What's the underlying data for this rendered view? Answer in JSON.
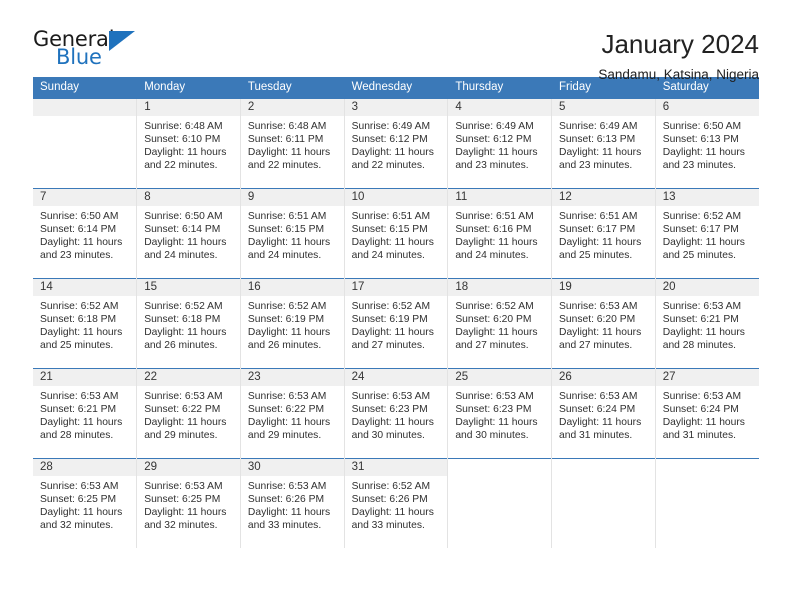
{
  "brand": {
    "word_one": "General",
    "word_two": "Blue",
    "triangle_icon": "blue-triangle-icon"
  },
  "header": {
    "title": "January 2024",
    "subtitle": "Sandamu, Katsina, Nigeria"
  },
  "theme": {
    "header_blue": "#3b79b8",
    "band_gray": "#f0f0f0",
    "brand_blue": "#1f72bd",
    "text": "#303030"
  },
  "weekday_headers": [
    "Sunday",
    "Monday",
    "Tuesday",
    "Wednesday",
    "Thursday",
    "Friday",
    "Saturday"
  ],
  "labels": {
    "sunrise_prefix": "Sunrise:",
    "sunset_prefix": "Sunset:",
    "daylight_prefix": "Daylight:"
  },
  "weeks": [
    [
      {
        "day": "",
        "blank": true
      },
      {
        "day": "1",
        "sunrise": "Sunrise: 6:48 AM",
        "sunset": "Sunset: 6:10 PM",
        "daylight_1": "Daylight: 11 hours",
        "daylight_2": "and 22 minutes."
      },
      {
        "day": "2",
        "sunrise": "Sunrise: 6:48 AM",
        "sunset": "Sunset: 6:11 PM",
        "daylight_1": "Daylight: 11 hours",
        "daylight_2": "and 22 minutes."
      },
      {
        "day": "3",
        "sunrise": "Sunrise: 6:49 AM",
        "sunset": "Sunset: 6:12 PM",
        "daylight_1": "Daylight: 11 hours",
        "daylight_2": "and 22 minutes."
      },
      {
        "day": "4",
        "sunrise": "Sunrise: 6:49 AM",
        "sunset": "Sunset: 6:12 PM",
        "daylight_1": "Daylight: 11 hours",
        "daylight_2": "and 23 minutes."
      },
      {
        "day": "5",
        "sunrise": "Sunrise: 6:49 AM",
        "sunset": "Sunset: 6:13 PM",
        "daylight_1": "Daylight: 11 hours",
        "daylight_2": "and 23 minutes."
      },
      {
        "day": "6",
        "sunrise": "Sunrise: 6:50 AM",
        "sunset": "Sunset: 6:13 PM",
        "daylight_1": "Daylight: 11 hours",
        "daylight_2": "and 23 minutes."
      }
    ],
    [
      {
        "day": "7",
        "sunrise": "Sunrise: 6:50 AM",
        "sunset": "Sunset: 6:14 PM",
        "daylight_1": "Daylight: 11 hours",
        "daylight_2": "and 23 minutes."
      },
      {
        "day": "8",
        "sunrise": "Sunrise: 6:50 AM",
        "sunset": "Sunset: 6:14 PM",
        "daylight_1": "Daylight: 11 hours",
        "daylight_2": "and 24 minutes."
      },
      {
        "day": "9",
        "sunrise": "Sunrise: 6:51 AM",
        "sunset": "Sunset: 6:15 PM",
        "daylight_1": "Daylight: 11 hours",
        "daylight_2": "and 24 minutes."
      },
      {
        "day": "10",
        "sunrise": "Sunrise: 6:51 AM",
        "sunset": "Sunset: 6:15 PM",
        "daylight_1": "Daylight: 11 hours",
        "daylight_2": "and 24 minutes."
      },
      {
        "day": "11",
        "sunrise": "Sunrise: 6:51 AM",
        "sunset": "Sunset: 6:16 PM",
        "daylight_1": "Daylight: 11 hours",
        "daylight_2": "and 24 minutes."
      },
      {
        "day": "12",
        "sunrise": "Sunrise: 6:51 AM",
        "sunset": "Sunset: 6:17 PM",
        "daylight_1": "Daylight: 11 hours",
        "daylight_2": "and 25 minutes."
      },
      {
        "day": "13",
        "sunrise": "Sunrise: 6:52 AM",
        "sunset": "Sunset: 6:17 PM",
        "daylight_1": "Daylight: 11 hours",
        "daylight_2": "and 25 minutes."
      }
    ],
    [
      {
        "day": "14",
        "sunrise": "Sunrise: 6:52 AM",
        "sunset": "Sunset: 6:18 PM",
        "daylight_1": "Daylight: 11 hours",
        "daylight_2": "and 25 minutes."
      },
      {
        "day": "15",
        "sunrise": "Sunrise: 6:52 AM",
        "sunset": "Sunset: 6:18 PM",
        "daylight_1": "Daylight: 11 hours",
        "daylight_2": "and 26 minutes."
      },
      {
        "day": "16",
        "sunrise": "Sunrise: 6:52 AM",
        "sunset": "Sunset: 6:19 PM",
        "daylight_1": "Daylight: 11 hours",
        "daylight_2": "and 26 minutes."
      },
      {
        "day": "17",
        "sunrise": "Sunrise: 6:52 AM",
        "sunset": "Sunset: 6:19 PM",
        "daylight_1": "Daylight: 11 hours",
        "daylight_2": "and 27 minutes."
      },
      {
        "day": "18",
        "sunrise": "Sunrise: 6:52 AM",
        "sunset": "Sunset: 6:20 PM",
        "daylight_1": "Daylight: 11 hours",
        "daylight_2": "and 27 minutes."
      },
      {
        "day": "19",
        "sunrise": "Sunrise: 6:53 AM",
        "sunset": "Sunset: 6:20 PM",
        "daylight_1": "Daylight: 11 hours",
        "daylight_2": "and 27 minutes."
      },
      {
        "day": "20",
        "sunrise": "Sunrise: 6:53 AM",
        "sunset": "Sunset: 6:21 PM",
        "daylight_1": "Daylight: 11 hours",
        "daylight_2": "and 28 minutes."
      }
    ],
    [
      {
        "day": "21",
        "sunrise": "Sunrise: 6:53 AM",
        "sunset": "Sunset: 6:21 PM",
        "daylight_1": "Daylight: 11 hours",
        "daylight_2": "and 28 minutes."
      },
      {
        "day": "22",
        "sunrise": "Sunrise: 6:53 AM",
        "sunset": "Sunset: 6:22 PM",
        "daylight_1": "Daylight: 11 hours",
        "daylight_2": "and 29 minutes."
      },
      {
        "day": "23",
        "sunrise": "Sunrise: 6:53 AM",
        "sunset": "Sunset: 6:22 PM",
        "daylight_1": "Daylight: 11 hours",
        "daylight_2": "and 29 minutes."
      },
      {
        "day": "24",
        "sunrise": "Sunrise: 6:53 AM",
        "sunset": "Sunset: 6:23 PM",
        "daylight_1": "Daylight: 11 hours",
        "daylight_2": "and 30 minutes."
      },
      {
        "day": "25",
        "sunrise": "Sunrise: 6:53 AM",
        "sunset": "Sunset: 6:23 PM",
        "daylight_1": "Daylight: 11 hours",
        "daylight_2": "and 30 minutes."
      },
      {
        "day": "26",
        "sunrise": "Sunrise: 6:53 AM",
        "sunset": "Sunset: 6:24 PM",
        "daylight_1": "Daylight: 11 hours",
        "daylight_2": "and 31 minutes."
      },
      {
        "day": "27",
        "sunrise": "Sunrise: 6:53 AM",
        "sunset": "Sunset: 6:24 PM",
        "daylight_1": "Daylight: 11 hours",
        "daylight_2": "and 31 minutes."
      }
    ],
    [
      {
        "day": "28",
        "sunrise": "Sunrise: 6:53 AM",
        "sunset": "Sunset: 6:25 PM",
        "daylight_1": "Daylight: 11 hours",
        "daylight_2": "and 32 minutes."
      },
      {
        "day": "29",
        "sunrise": "Sunrise: 6:53 AM",
        "sunset": "Sunset: 6:25 PM",
        "daylight_1": "Daylight: 11 hours",
        "daylight_2": "and 32 minutes."
      },
      {
        "day": "30",
        "sunrise": "Sunrise: 6:53 AM",
        "sunset": "Sunset: 6:26 PM",
        "daylight_1": "Daylight: 11 hours",
        "daylight_2": "and 33 minutes."
      },
      {
        "day": "31",
        "sunrise": "Sunrise: 6:52 AM",
        "sunset": "Sunset: 6:26 PM",
        "daylight_1": "Daylight: 11 hours",
        "daylight_2": "and 33 minutes."
      },
      {
        "day": "",
        "blank": true,
        "trailing": true
      },
      {
        "day": "",
        "blank": true,
        "trailing": true
      },
      {
        "day": "",
        "blank": true,
        "trailing": true
      }
    ]
  ]
}
